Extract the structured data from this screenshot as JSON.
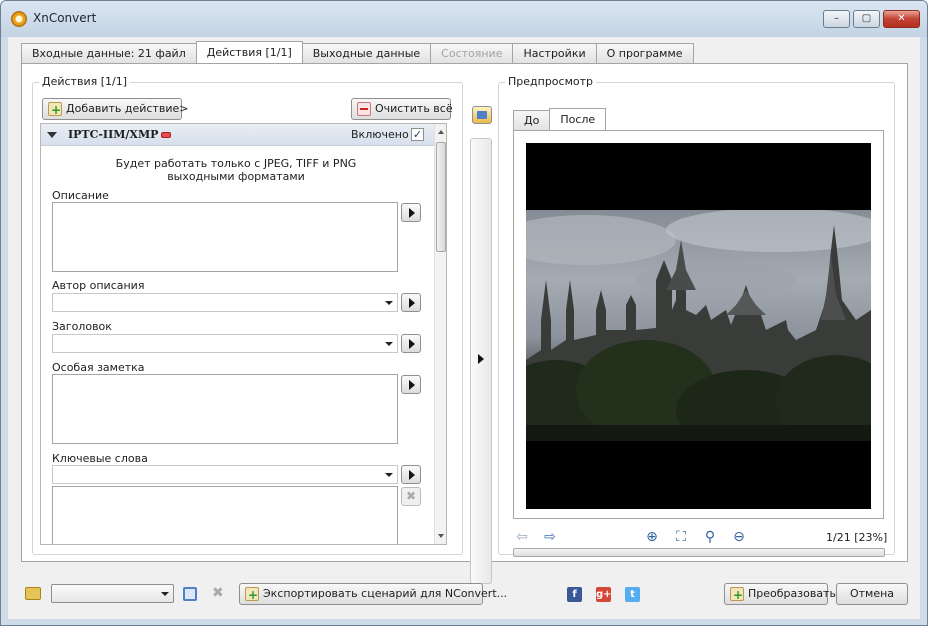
{
  "window": {
    "title": "XnConvert",
    "min_glyph": "–",
    "max_glyph": "▢",
    "close_glyph": "✕"
  },
  "tabs": [
    {
      "label": "Входные данные: 21 файл"
    },
    {
      "label": "Действия [1/1]"
    },
    {
      "label": "Выходные данные"
    },
    {
      "label": "Состояние"
    },
    {
      "label": "Настройки"
    },
    {
      "label": "О программе"
    }
  ],
  "actions": {
    "group_title": "Действия [1/1]",
    "add_label": "Добавить действие>",
    "clear_label": "Очистить всё",
    "item": {
      "name": "IPTC-IIM/XMP",
      "enabled_label": "Включено",
      "enabled_mark": "✓",
      "note_line1": "Будет работать только с JPEG, TIFF и PNG",
      "note_line2": "выходными форматами"
    },
    "fields": {
      "description": "Описание",
      "description_author": "Автор описания",
      "headline": "Заголовок",
      "special_note": "Особая заметка",
      "keywords": "Ключевые слова"
    },
    "remove_glyph": "✖"
  },
  "preview": {
    "group_title": "Предпросмотр",
    "tab_before": "До",
    "tab_after": "После",
    "page_info": "1/21 [23%]",
    "icons": {
      "prev": "⇦",
      "next": "⇨",
      "zoom_in": "⊕",
      "fit": "⛶",
      "zoom": "⚲",
      "zoom_out": "⊖"
    }
  },
  "bottom": {
    "export_label": "Экспортировать сценарий для NConvert...",
    "convert_label": "Преобразовать",
    "cancel_label": "Отмена",
    "facebook": "f",
    "google": "g+",
    "twitter": "t",
    "delete_glyph": "✖"
  },
  "colors": {
    "accent": "#3c6eb4",
    "facebook": "#3b5998",
    "google": "#d34836",
    "twitter": "#55acee"
  }
}
